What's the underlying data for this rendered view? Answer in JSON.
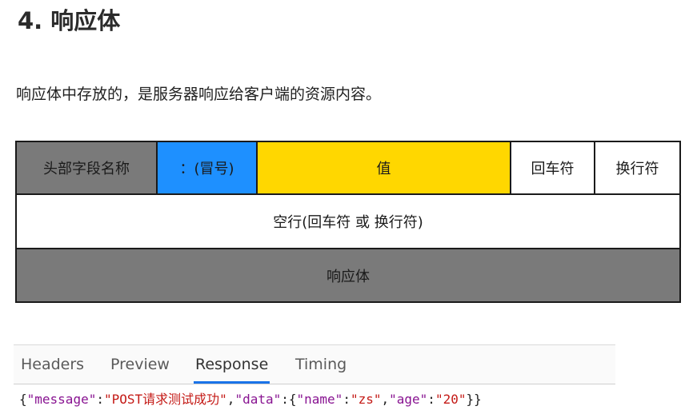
{
  "heading": "4. 响应体",
  "paragraph": "响应体中存放的，是服务器响应给客户端的资源内容。",
  "diagram": {
    "row1": {
      "name": "头部字段名称",
      "colon": "：(冒号)",
      "value": "值",
      "cr": "回车符",
      "lf": "换行符"
    },
    "row2": "空行(回车符 或 换行符)",
    "row3": "响应体",
    "colors": {
      "name": "#7a7a7a",
      "colon": "#1e90ff",
      "value": "#ffd700",
      "body": "#7a7a7a"
    }
  },
  "devtools": {
    "tabs": [
      "Headers",
      "Preview",
      "Response",
      "Timing"
    ],
    "active_tab": "Response",
    "response": {
      "open_brace": "{",
      "k_message": "\"message\"",
      "colon1": ":",
      "v_message": "\"POST请求测试成功\"",
      "comma1": ",",
      "k_data": "\"data\"",
      "colon2": ":",
      "open_brace2": "{",
      "k_name": "\"name\"",
      "colon3": ":",
      "v_name": "\"zs\"",
      "comma2": ",",
      "k_age": "\"age\"",
      "colon4": ":",
      "v_age": "\"20\"",
      "close": "}}"
    }
  }
}
